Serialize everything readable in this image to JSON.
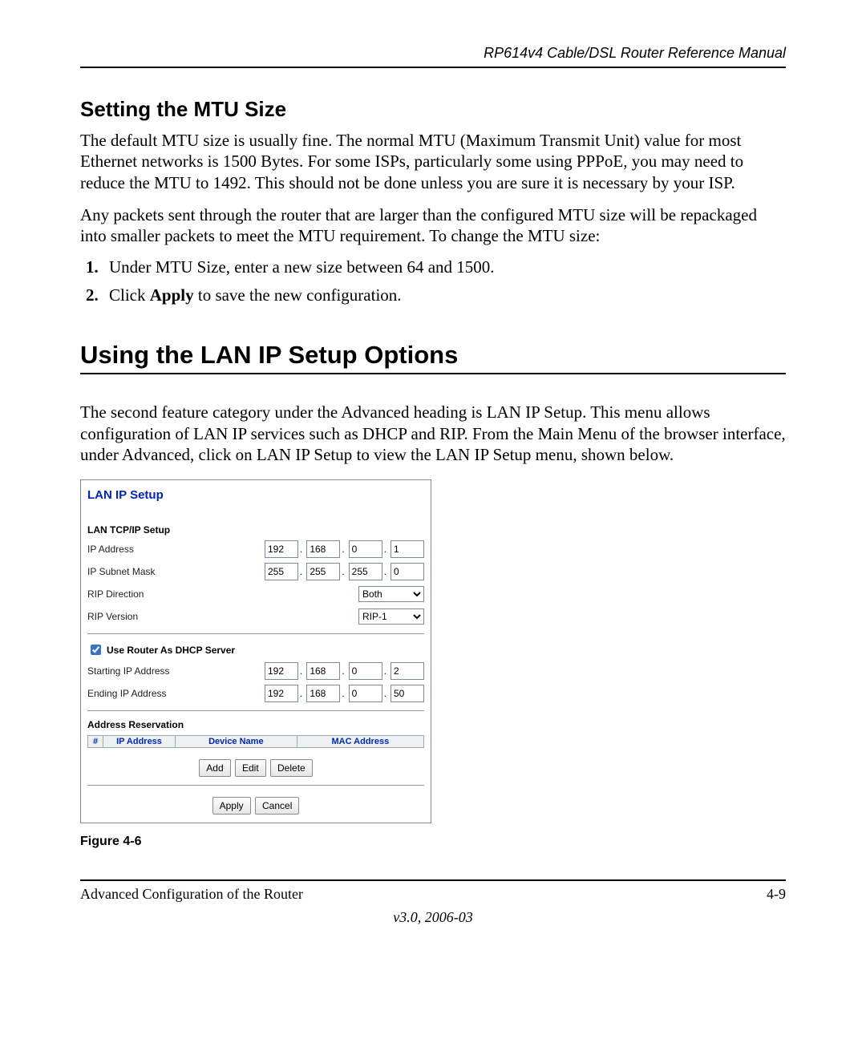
{
  "header": "RP614v4 Cable/DSL Router Reference Manual",
  "section1_title": "Setting the MTU Size",
  "para1": "The default MTU size is usually fine. The normal MTU (Maximum Transmit Unit) value for most Ethernet networks is 1500 Bytes. For some ISPs, particularly some using PPPoE, you may need to reduce the MTU to 1492. This should not be done unless you are sure it is necessary by your ISP.",
  "para2": "Any packets sent through the router that are larger than the configured MTU size will be repackaged into smaller packets to meet the MTU requirement. To change the MTU size:",
  "steps": {
    "s1": "Under MTU Size, enter a new size between 64 and 1500.",
    "s2_prefix": "Click ",
    "s2_bold": "Apply",
    "s2_suffix": " to save the new configuration."
  },
  "section2_title": "Using the LAN IP Setup Options",
  "para3": "The second feature category under the Advanced heading is LAN IP Setup. This menu allows configuration of LAN IP services such as DHCP and RIP. From the Main Menu of the browser interface, under Advanced, click on LAN IP Setup to view the LAN IP Setup menu, shown below.",
  "panel": {
    "title": "LAN IP Setup",
    "group1": "LAN TCP/IP Setup",
    "ip_label": "IP Address",
    "ip": [
      "192",
      "168",
      "0",
      "1"
    ],
    "mask_label": "IP Subnet Mask",
    "mask": [
      "255",
      "255",
      "255",
      "0"
    ],
    "rip_dir_label": "RIP Direction",
    "rip_dir": "Both",
    "rip_ver_label": "RIP Version",
    "rip_ver": "RIP-1",
    "dhcp_checkbox_label": "Use Router As DHCP Server",
    "start_label": "Starting IP Address",
    "start_ip": [
      "192",
      "168",
      "0",
      "2"
    ],
    "end_label": "Ending IP Address",
    "end_ip": [
      "192",
      "168",
      "0",
      "50"
    ],
    "group3": "Address Reservation",
    "th_hash": "#",
    "th_ip": "IP Address",
    "th_dev": "Device Name",
    "th_mac": "MAC Address",
    "buttons": {
      "add": "Add",
      "edit": "Edit",
      "delete": "Delete",
      "apply": "Apply",
      "cancel": "Cancel"
    }
  },
  "figure": "Figure 4-6",
  "footer_left": "Advanced Configuration of the Router",
  "footer_right": "4-9",
  "version": "v3.0, 2006-03"
}
